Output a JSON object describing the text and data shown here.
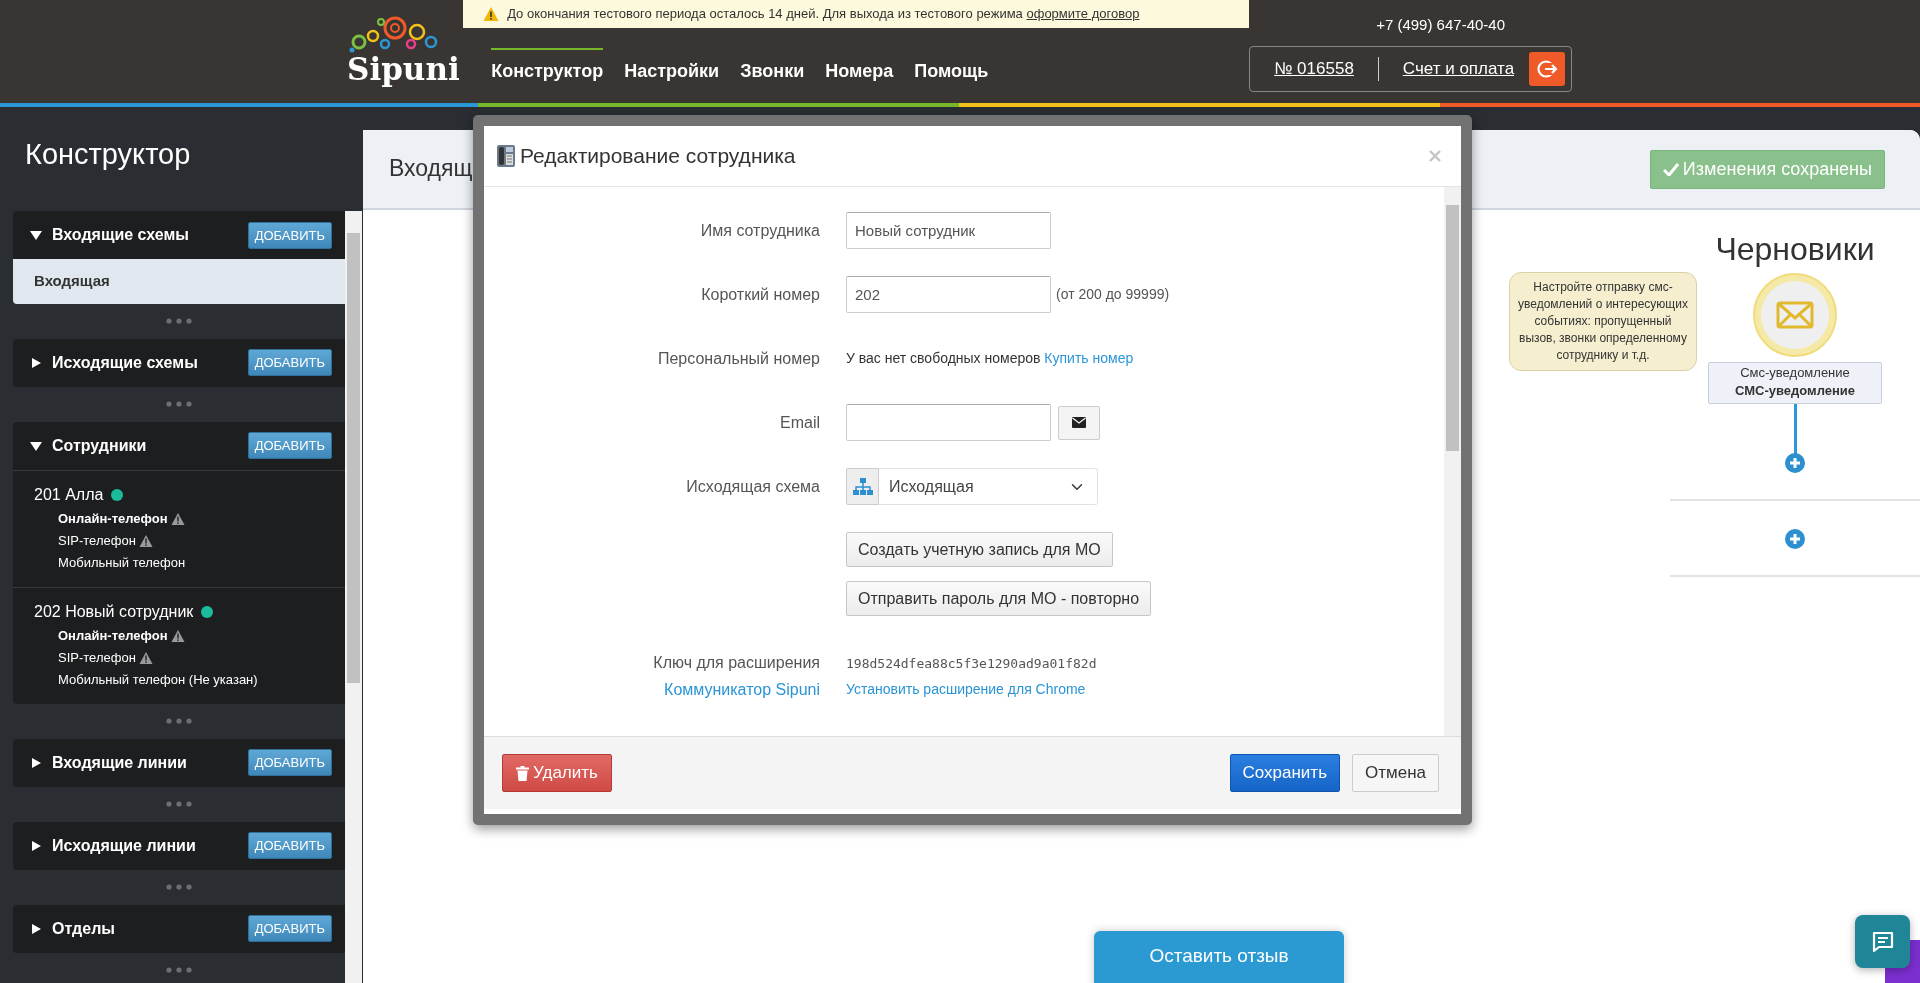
{
  "trial_banner": {
    "text": "До окончания тестового периода осталось 14 дней. Для выхода из тестового режима",
    "link": "оформите договор"
  },
  "logo": {
    "text": "Sipuni"
  },
  "nav": [
    {
      "label": "Конструктор",
      "selected": true
    },
    {
      "label": "Настройки",
      "selected": false
    },
    {
      "label": "Звонки",
      "selected": false
    },
    {
      "label": "Номера",
      "selected": false
    },
    {
      "label": "Помощь",
      "selected": false
    }
  ],
  "phone": "+7 (499) 647-40-40",
  "account": {
    "number": "№ 016558",
    "billing": "Счет и оплата"
  },
  "sidebar": {
    "title": "Конструктор",
    "sections": [
      {
        "title": "Входящие схемы",
        "expanded": true,
        "add_label": "ДОБАВИТЬ",
        "items": [
          {
            "name": "Входящая",
            "selected": true
          }
        ]
      },
      {
        "title": "Исходящие схемы",
        "expanded": false,
        "add_label": "ДОБАВИТЬ"
      },
      {
        "title": "Сотрудники",
        "expanded": true,
        "add_label": "ДОБАВИТЬ",
        "employees": [
          {
            "name": "201 Алла",
            "color": "#1abc9c",
            "devices": [
              {
                "kind": "online",
                "label": "Онлайн-телефон",
                "warning": true
              },
              {
                "kind": "sip",
                "label": "SIP-телефон",
                "warning": true
              },
              {
                "kind": "mobile",
                "label": "Мобильный телефон",
                "warning": false
              }
            ]
          },
          {
            "name": "202 Новый сотрудник",
            "color": "#1abc9c",
            "devices": [
              {
                "kind": "online",
                "label": "Онлайн-телефон",
                "warning": true
              },
              {
                "kind": "sip",
                "label": "SIP-телефон",
                "warning": true
              },
              {
                "kind": "mobile",
                "label": "Мобильный телефон (Не указан)",
                "warning": false
              }
            ]
          }
        ]
      },
      {
        "title": "Входящие линии",
        "expanded": false,
        "add_label": "ДОБАВИТЬ"
      },
      {
        "title": "Исходящие линии",
        "expanded": false,
        "add_label": "ДОБАВИТЬ"
      },
      {
        "title": "Отделы",
        "expanded": false,
        "add_label": "ДОБАВИТЬ"
      }
    ]
  },
  "main": {
    "heading": "Входящ",
    "save_status": "Изменения сохранены",
    "drafts": {
      "title": "Черновики",
      "hint": "Настройте отправку смс-уведомлений о интересующих событиях: пропущенный вызов, звонки определенному сотруднику и т.д.",
      "node": {
        "type": "Смс-уведомление",
        "name": "СМС-уведомление"
      }
    }
  },
  "modal": {
    "title": "Редактирование сотрудника",
    "fields": [
      {
        "kind": "text",
        "label": "Имя сотрудника",
        "value": "Новый сотрудник"
      },
      {
        "kind": "text",
        "label": "Короткий номер",
        "value": "202",
        "hint": "(от 200 до 99999)"
      },
      {
        "kind": "info",
        "label": "Персональный номер",
        "text": "У вас нет свободных номеров",
        "link": "Купить номер"
      },
      {
        "kind": "email",
        "label": "Email"
      },
      {
        "kind": "select",
        "label": "Исходящая схема",
        "value": "Исходящая"
      },
      {
        "kind": "buttons",
        "buttons": [
          "Создать учетную запись для МО",
          "Отправить пароль для МО - повторно"
        ]
      },
      {
        "kind": "key",
        "label": "Ключ для расширения",
        "label_link": "Коммуникатор Sipuni",
        "value": "198d524dfea88c5f3e1290ad9a01f82d",
        "link": "Установить расширение для Chrome"
      }
    ],
    "delete": "Удалить",
    "save": "Сохранить",
    "cancel": "Отмена"
  },
  "feedback_button": "Оставить отзыв"
}
